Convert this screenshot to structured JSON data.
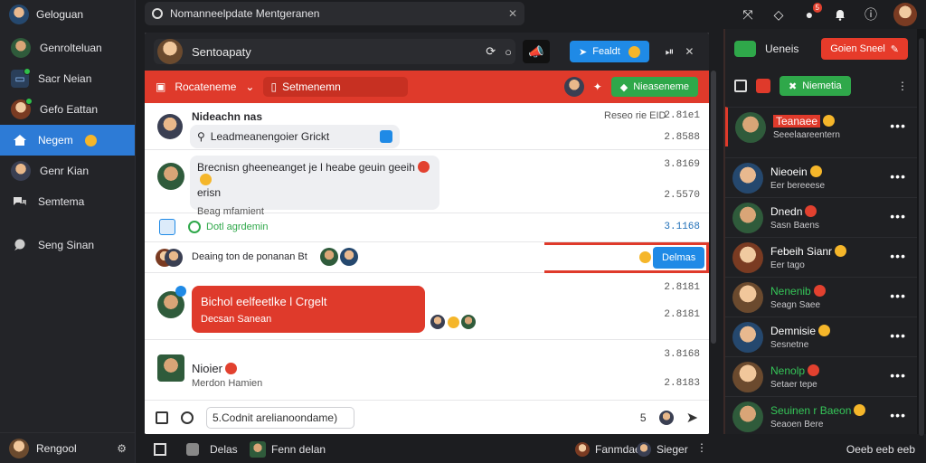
{
  "sidebar": {
    "header": {
      "title": "Geloguan"
    },
    "items": [
      {
        "label": "Genrolteluan"
      },
      {
        "label": "Sacr Neian"
      },
      {
        "label": "Gefo Eattan"
      },
      {
        "label": "Negem"
      },
      {
        "label": "Genr Kian"
      },
      {
        "label": "Semtema"
      },
      {
        "label": "Seng Sinan"
      }
    ],
    "footer": {
      "label": "Rengool"
    }
  },
  "topbar": {
    "search_text": "Nomanneelpdate Mentgeranen",
    "notification_count": "5"
  },
  "chat": {
    "header": {
      "title": "Sentoapaty",
      "primary_button": "Fealdt"
    },
    "banner": {
      "label": "Rocateneme",
      "pill_text": "Setmenemn",
      "button": "Nieaseneme"
    },
    "messages": [
      {
        "sender": "Nideachn nas",
        "text": "Leadmeanengoier Grickt",
        "meta": "Reseo rie EID",
        "time_top": "2.81e1",
        "time_bottom": "2.8588"
      },
      {
        "text_line1": "Brecnisn gheeneanget je l heabe geuin geeih",
        "text_line2": "erisn",
        "sub": "Beag mfamient",
        "time_top": "3.8169",
        "time_bottom": "2.5570"
      },
      {
        "status": "Dotl agrdemin",
        "time": "3.1168"
      },
      {
        "text": "Deaing ton de ponanan Bt",
        "reply_button": "Delmas"
      },
      {
        "text": "Bichol eelfeetlke l Crgelt",
        "sub": "Decsan Sanean",
        "time_top": "2.8181",
        "time_bottom": "2.8181"
      },
      {
        "sender": "Nioier",
        "sub": "Merdon Hamien",
        "time_top": "3.8168",
        "time_bottom": "2.8183"
      }
    ],
    "composer": {
      "placeholder": "5.Codnit arelianoondame)",
      "count": "5"
    }
  },
  "right_panel": {
    "title": "Ueneis",
    "action_button": "Goien Sneel",
    "tab_label": "Niemetia",
    "contacts": [
      {
        "name": "Teanaee",
        "sub": "Seeelaareentern"
      },
      {
        "name": "Nieoein",
        "sub": "Eer bereeese"
      },
      {
        "name": "Dnedn",
        "sub": "Sasn Baens"
      },
      {
        "name": "Febeih Sianr",
        "sub": "Eer tago"
      },
      {
        "name": "Nenenib",
        "sub": "Seagn Saee"
      },
      {
        "name": "Demnisie",
        "sub": "Sesnetne"
      },
      {
        "name": "Nenolp",
        "sub": "Setaer tepe"
      },
      {
        "name": "Seuinen r Baeon",
        "sub": "Seaoen Bere"
      }
    ]
  },
  "bottombar": {
    "item1": "Delas",
    "item2": "Fenn delan",
    "item3": "Fanmdae",
    "item4": "Sieger",
    "right_text": "Oeeb eeb eeb"
  },
  "colors": {
    "accent_blue": "#2d7bd6",
    "accent_red": "#df3a2b",
    "accent_green": "#2fa84a"
  }
}
